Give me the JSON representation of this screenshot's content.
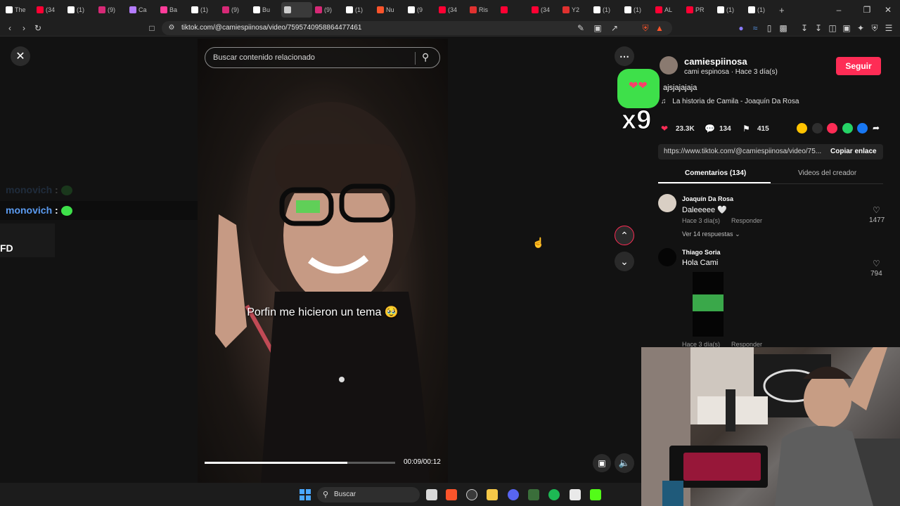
{
  "browser": {
    "tabs": [
      {
        "label": "The",
        "color": "#ffffff"
      },
      {
        "label": "(34",
        "color": "#ff0033"
      },
      {
        "label": "(1)",
        "color": "#ffffff"
      },
      {
        "label": "(9)",
        "color": "#d62976"
      },
      {
        "label": "Ca",
        "color": "#b47cff"
      },
      {
        "label": "Ba",
        "color": "#ff3d9a"
      },
      {
        "label": "(1)",
        "color": "#ffffff"
      },
      {
        "label": "(9)",
        "color": "#d62976"
      },
      {
        "label": "Bu",
        "color": "#ffffff"
      },
      {
        "label": "",
        "color": "#cccccc"
      },
      {
        "label": "(9)",
        "color": "#d62976"
      },
      {
        "label": "(1)",
        "color": "#ffffff"
      },
      {
        "label": "Nu",
        "color": "#fb542b"
      },
      {
        "label": "(9",
        "color": "#ffffff"
      },
      {
        "label": "(34",
        "color": "#ff0033"
      },
      {
        "label": "Ris",
        "color": "#e0312f"
      },
      {
        "label": "",
        "color": "#ff0033"
      },
      {
        "label": "(34",
        "color": "#ff0033"
      },
      {
        "label": "Y2",
        "color": "#e0312f"
      },
      {
        "label": "(1)",
        "color": "#ffffff"
      },
      {
        "label": "(1)",
        "color": "#ffffff"
      },
      {
        "label": "AL",
        "color": "#ff0033"
      },
      {
        "label": "PR",
        "color": "#ff0033"
      },
      {
        "label": "(1)",
        "color": "#ffffff"
      },
      {
        "label": "(1)",
        "color": "#ffffff"
      }
    ],
    "new_tab": "+",
    "url": "tiktok.com/@camiespiinosa/video/7595740958864477461"
  },
  "video": {
    "search_placeholder": "Buscar contenido relacionado",
    "caption": "Porfin me hicieron un tema 🥹",
    "progress": 0.75,
    "timecode": "00:09/00:12"
  },
  "overlay": {
    "chat_user_faded": "monovich",
    "chat_user": "monovich",
    "chat_sep": ":",
    "ticker": "FD",
    "emote_count": "x9"
  },
  "panel": {
    "username": "camiespiinosa",
    "display_line": "cami espinosa · Hace 3 día(s)",
    "follow_label": "Seguir",
    "description": "ajsjajajaja",
    "music": "La historia de Camila - Joaquín Da Rosa",
    "likes": "23.3K",
    "comments_count": "134",
    "saves": "415",
    "link": "https://www.tiktok.com/@camiespiinosa/video/75...",
    "copy_label": "Copiar enlace",
    "tab_comments": "Comentarios (134)",
    "tab_creator": "Videos del creador",
    "comments": [
      {
        "author": "Joaquín Da Rosa",
        "text": "Daleeeee 🤍",
        "meta": "Hace 3 día(s)",
        "reply": "Responder",
        "likes": "1477",
        "replies": "Ver 14 respuestas"
      },
      {
        "author": "Thiago Soria",
        "text": "Hola Cami",
        "meta": "Hace 3 día(s)",
        "reply": "Responder",
        "likes": "794"
      }
    ]
  },
  "taskbar": {
    "search_label": "Buscar"
  },
  "colors": {
    "accent": "#fe2c55",
    "chat_name": "#5b9bf0",
    "emote_green": "#3ee04a"
  }
}
